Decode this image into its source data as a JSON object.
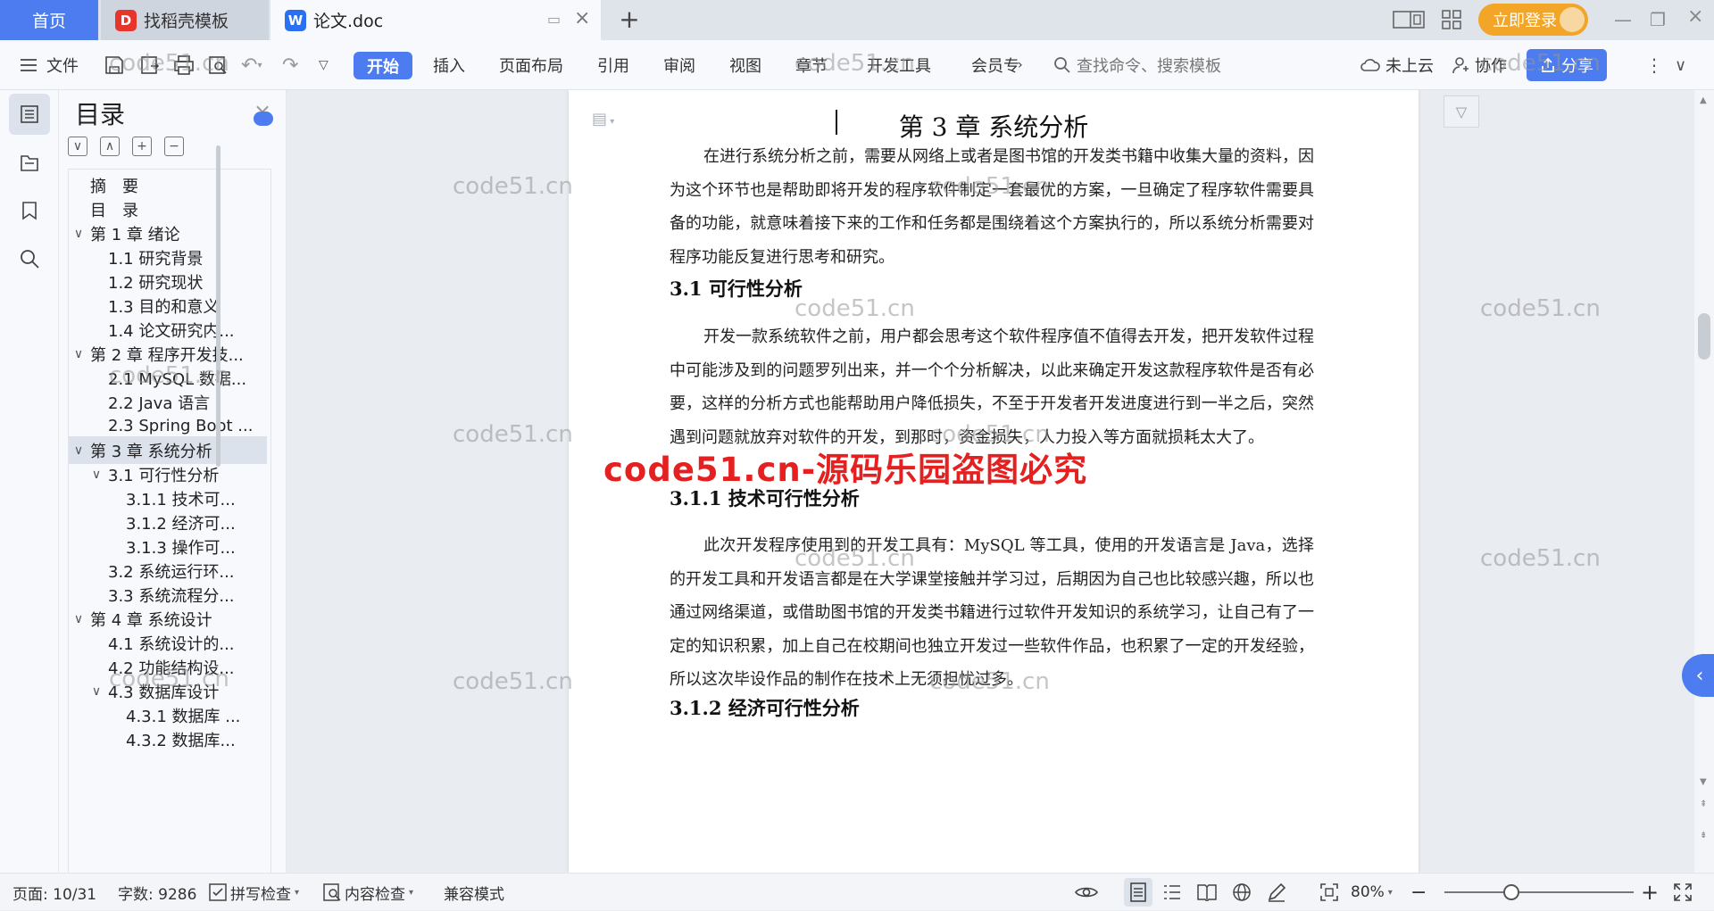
{
  "tabs": {
    "home": "首页",
    "daoke": "找稻壳模板",
    "document": "论文.doc"
  },
  "topbar": {
    "login": "立即登录"
  },
  "ribbon": {
    "file": "文件",
    "tabs": [
      "开始",
      "插入",
      "页面布局",
      "引用",
      "审阅",
      "视图",
      "章节",
      "开发工具",
      "会员专"
    ],
    "search_placeholder": "查找命令、搜索模板",
    "cloud": "未上云",
    "collab": "协作",
    "share": "分享"
  },
  "toc": {
    "title": "目录",
    "items": [
      {
        "label": "摘　要",
        "level": 0,
        "arrow": ""
      },
      {
        "label": "目　录",
        "level": 0,
        "arrow": ""
      },
      {
        "label": "第 1 章  绪论",
        "level": 0,
        "arrow": "∨"
      },
      {
        "label": "1.1  研究背景",
        "level": 1,
        "arrow": ""
      },
      {
        "label": "1.2  研究现状",
        "level": 1,
        "arrow": ""
      },
      {
        "label": "1.3  目的和意义",
        "level": 1,
        "arrow": ""
      },
      {
        "label": "1.4  论文研究内...",
        "level": 1,
        "arrow": ""
      },
      {
        "label": "第 2 章  程序开发技...",
        "level": 0,
        "arrow": "∨"
      },
      {
        "label": "2.1 MySQL 数据...",
        "level": 1,
        "arrow": ""
      },
      {
        "label": "2.2 Java 语言",
        "level": 1,
        "arrow": ""
      },
      {
        "label": "2.3 Spring Boot ...",
        "level": 1,
        "arrow": ""
      },
      {
        "label": "第 3 章  系统分析",
        "level": 0,
        "arrow": "∨",
        "selected": true
      },
      {
        "label": "3.1 可行性分析",
        "level": 1,
        "arrow": "∨"
      },
      {
        "label": "3.1.1 技术可...",
        "level": 2,
        "arrow": ""
      },
      {
        "label": "3.1.2 经济可...",
        "level": 2,
        "arrow": ""
      },
      {
        "label": "3.1.3 操作可...",
        "level": 2,
        "arrow": ""
      },
      {
        "label": "3.2 系统运行环...",
        "level": 1,
        "arrow": ""
      },
      {
        "label": "3.3 系统流程分...",
        "level": 1,
        "arrow": ""
      },
      {
        "label": "第 4 章  系统设计",
        "level": 0,
        "arrow": "∨"
      },
      {
        "label": "4.1  系统设计的...",
        "level": 1,
        "arrow": ""
      },
      {
        "label": "4.2  功能结构设...",
        "level": 1,
        "arrow": ""
      },
      {
        "label": "4.3  数据库设计",
        "level": 1,
        "arrow": "∨"
      },
      {
        "label": "4.3.1  数据库 ...",
        "level": 2,
        "arrow": ""
      },
      {
        "label": "4.3.2  数据库...",
        "level": 2,
        "arrow": ""
      }
    ]
  },
  "doc": {
    "chapter_title": "第 3 章  系统分析",
    "intro": "在进行系统分析之前，需要从网络上或者是图书馆的开发类书籍中收集大量的资料，因为这个环节也是帮助即将开发的程序软件制定一套最优的方案，一旦确定了程序软件需要具备的功能，就意味着接下来的工作和任务都是围绕着这个方案执行的，所以系统分析需要对程序功能反复进行思考和研究。",
    "h_31": "3.1 可行性分析",
    "p_31": "开发一款系统软件之前，用户都会思考这个软件程序值不值得去开发，把开发软件过程中可能涉及到的问题罗列出来，并一个个分析解决，以此来确定开发这款程序软件是否有必要，这样的分析方式也能帮助用户降低损失，不至于开发者开发进度进行到一半之后，突然遇到问题就放弃对软件的开发，到那时，资金损失，人力投入等方面就损耗太大了。",
    "h_311": "3.1.1 技术可行性分析",
    "p_311": "此次开发程序使用到的开发工具有：MySQL 等工具，使用的开发语言是 Java，选择的开发工具和开发语言都是在大学课堂接触并学习过，后期因为自己也比较感兴趣，所以也通过网络渠道，或借助图书馆的开发类书籍进行过软件开发知识的系统学习，让自己有了一定的知识积累，加上自己在校期间也独立开发过一些软件作品，也积累了一定的开发经验，所以这次毕设作品的制作在技术上无须担忧过多。",
    "h_312": "3.1.2 经济可行性分析"
  },
  "watermarks": {
    "gray": "code51.cn",
    "red": "code51.cn-源码乐园盗图必究"
  },
  "status": {
    "page": "页面: 10/31",
    "words": "字数: 9286",
    "spell": "拼写检查",
    "content_check": "内容检查",
    "compat": "兼容模式",
    "zoom": "80%"
  },
  "colors": {
    "accent": "#4c7cf0",
    "login": "#f2a527",
    "watermark_red": "#e52020"
  },
  "icons": [
    "menu-icon",
    "save-icon",
    "undo-icon",
    "redo-icon",
    "search-icon",
    "cloud-icon",
    "collab-icon",
    "share-icon",
    "more-icon",
    "toc-icon",
    "bookmark-icon",
    "eye-icon",
    "zoom-in-icon",
    "zoom-out-icon",
    "fullscreen-icon"
  ]
}
